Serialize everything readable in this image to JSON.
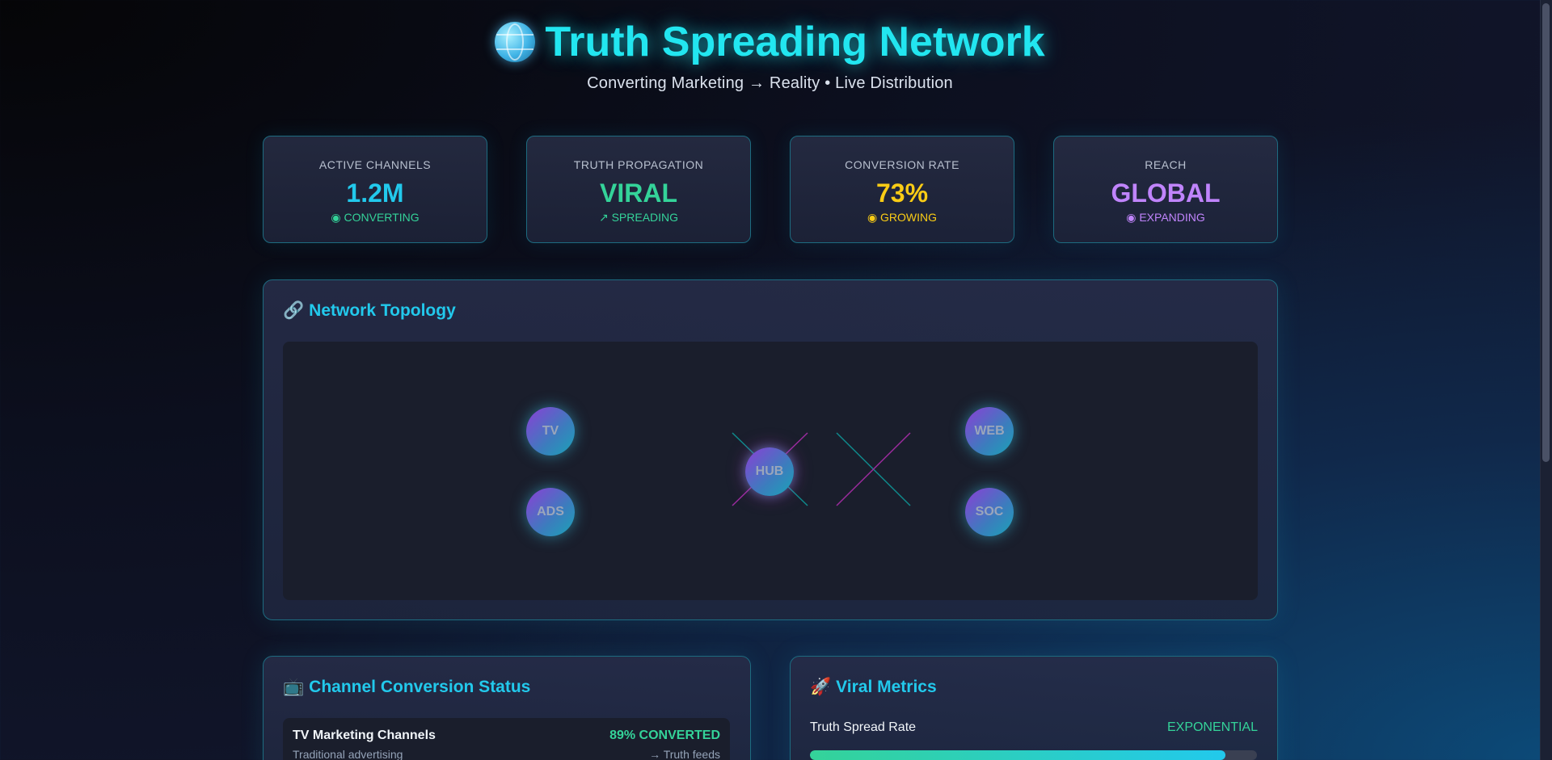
{
  "header": {
    "title": "Truth Spreading Network",
    "icon": "globe-icon",
    "subtitle": "Converting Marketing → Reality • Live Distribution"
  },
  "stats": [
    {
      "label": "ACTIVE CHANNELS",
      "value": "1.2M",
      "status": "◉ CONVERTING",
      "value_color": "#22c9ec",
      "status_color": "#34d399"
    },
    {
      "label": "TRUTH PROPAGATION",
      "value": "VIRAL",
      "status": "↗ SPREADING",
      "value_color": "#34d399",
      "status_color": "#34d399"
    },
    {
      "label": "CONVERSION RATE",
      "value": "73%",
      "status": "◉ GROWING",
      "value_color": "#facc15",
      "status_color": "#facc15"
    },
    {
      "label": "REACH",
      "value": "GLOBAL",
      "status": "◉ EXPANDING",
      "value_color": "#c084fc",
      "status_color": "#c084fc"
    }
  ],
  "topology": {
    "title": "Network Topology",
    "icon": "link-icon",
    "nodes": {
      "tv": "TV",
      "ads": "ADS",
      "hub": "HUB",
      "web": "WEB",
      "soc": "SOC"
    }
  },
  "channels": {
    "title": "Channel Conversion Status",
    "icon": "tv-icon",
    "rows": [
      {
        "name": "TV Marketing Channels",
        "sub": "Traditional advertising",
        "percent": "89% CONVERTED",
        "out": "→ Truth feeds"
      }
    ]
  },
  "viral": {
    "title": "Viral Metrics",
    "icon": "rocket-icon",
    "metrics": [
      {
        "label": "Truth Spread Rate",
        "value": "EXPONENTIAL",
        "progress": 0.93
      }
    ]
  }
}
